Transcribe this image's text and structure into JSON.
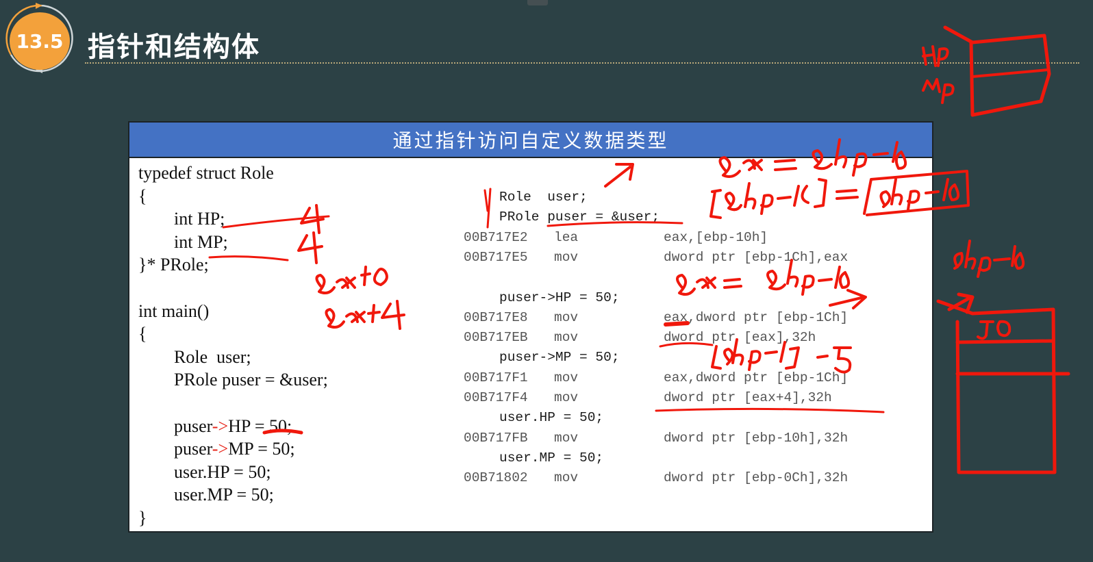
{
  "slide": {
    "section_number": "13.5",
    "title": "指针和结构体"
  },
  "panel": {
    "header": "通过指针访问自定义数据类型",
    "source_code": [
      "typedef struct Role",
      "{",
      "        int HP;",
      "        int MP;",
      "}* PRole;",
      "",
      "int main()",
      "{",
      "        Role  user;",
      "        PRole puser = &user;",
      "",
      "        puser->HP = 50;",
      "        puser->MP = 50;",
      "        user.HP = 50;",
      "        user.MP = 50;",
      "}"
    ],
    "disassembly": [
      {
        "kind": "src",
        "text": "Role  user;"
      },
      {
        "kind": "src",
        "text": "PRole puser = &user;"
      },
      {
        "kind": "ins",
        "addr": "00B717E2",
        "op": "lea",
        "arg": "eax,[ebp-10h]"
      },
      {
        "kind": "ins",
        "addr": "00B717E5",
        "op": "mov",
        "arg": "dword ptr [ebp-1Ch],eax"
      },
      {
        "kind": "blank"
      },
      {
        "kind": "src",
        "text": "puser->HP = 50;"
      },
      {
        "kind": "ins",
        "addr": "00B717E8",
        "op": "mov",
        "arg": "eax,dword ptr [ebp-1Ch]"
      },
      {
        "kind": "ins",
        "addr": "00B717EB",
        "op": "mov",
        "arg": "dword ptr [eax],32h"
      },
      {
        "kind": "src",
        "text": "puser->MP = 50;"
      },
      {
        "kind": "ins",
        "addr": "00B717F1",
        "op": "mov",
        "arg": "eax,dword ptr [ebp-1Ch]"
      },
      {
        "kind": "ins",
        "addr": "00B717F4",
        "op": "mov",
        "arg": "dword ptr [eax+4],32h"
      },
      {
        "kind": "src",
        "text": "user.HP = 50;"
      },
      {
        "kind": "ins",
        "addr": "00B717FB",
        "op": "mov",
        "arg": "dword ptr [ebp-10h],32h"
      },
      {
        "kind": "src",
        "text": "user.MP = 50;"
      },
      {
        "kind": "ins",
        "addr": "00B71802",
        "op": "mov",
        "arg": "dword ptr [ebp-0Ch],32h"
      }
    ]
  },
  "colors": {
    "background": "#2c4145",
    "badge": "#f3a13b",
    "header": "#4472c4",
    "arrow": "#e62318",
    "ink": "#f0180c"
  }
}
